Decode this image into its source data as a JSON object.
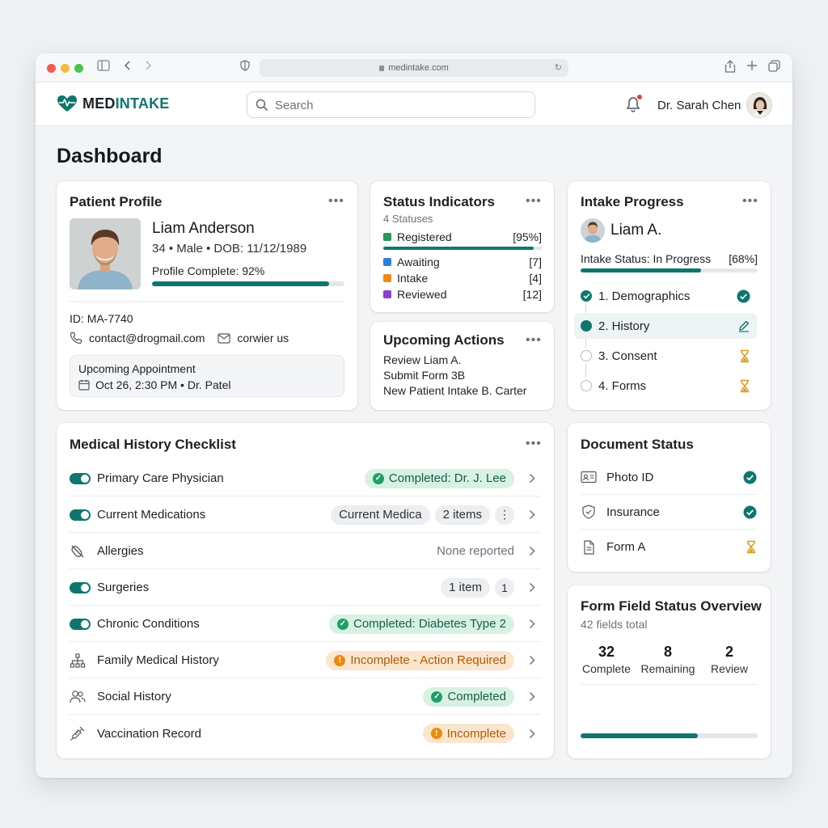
{
  "browser": {
    "url": "medintake.com"
  },
  "header": {
    "logo_med": "MED",
    "logo_intake": "INTAKE",
    "search_placeholder": "Search",
    "user_name": "Dr. Sarah Chen"
  },
  "page": {
    "title": "Dashboard"
  },
  "patient_profile": {
    "title": "Patient Profile",
    "name": "Liam Anderson",
    "meta": "34 • Male • DOB: 11/12/1989",
    "profile_complete_label": "Profile Complete: 92%",
    "profile_complete_fraction": 0.92,
    "id": "ID: MA-7740",
    "email": "contact@drogmail.com",
    "secondary_contact": "corwier us",
    "appointment_label": "Upcoming Appointment",
    "appointment_detail": "Oct 26, 2:30 PM • Dr. Patel"
  },
  "status_indicators": {
    "title": "Status Indicators",
    "subtitle": "4 Statuses",
    "registered_bar_fraction": 0.95,
    "rows": [
      {
        "label": "Registered",
        "value": "[95%]",
        "color": "#1f9d55"
      },
      {
        "label": "Awaiting",
        "value": "[7]",
        "color": "#2f7fd8"
      },
      {
        "label": "Intake",
        "value": "[4]",
        "color": "#ee8a12"
      },
      {
        "label": "Reviewed",
        "value": "[12]",
        "color": "#8a3fd1"
      }
    ]
  },
  "upcoming_actions": {
    "title": "Upcoming Actions",
    "items": [
      "Review Liam A.",
      "Submit Form 3B",
      "New Patient Intake B. Carter"
    ]
  },
  "intake_progress": {
    "title": "Intake Progress",
    "patient": "Liam A.",
    "status_label": "Intake Status: In Progress",
    "status_value": "[68%]",
    "progress_fraction": 0.68,
    "steps": [
      {
        "label": "1. Demographics",
        "state": "complete"
      },
      {
        "label": "2. History",
        "state": "active"
      },
      {
        "label": "3. Consent",
        "state": "pending"
      },
      {
        "label": "4. Forms",
        "state": "pending"
      }
    ]
  },
  "medical_history": {
    "title": "Medical History Checklist",
    "rows": [
      {
        "label": "Primary Care Physician",
        "status": "Completed: Dr. J. Lee"
      },
      {
        "label": "Current Medications",
        "chip1": "Current Medica",
        "chip2": "2 items"
      },
      {
        "label": "Allergies",
        "status": "None reported"
      },
      {
        "label": "Surgeries",
        "chip1": "1 item",
        "chip2": "1"
      },
      {
        "label": "Chronic Conditions",
        "status": "Completed: Diabetes Type 2"
      },
      {
        "label": "Family Medical History",
        "status": "Incomplete - Action Required"
      },
      {
        "label": "Social History",
        "status": "Completed"
      },
      {
        "label": "Vaccination Record",
        "status": "Incomplete"
      }
    ]
  },
  "document_status": {
    "title": "Document Status",
    "rows": [
      {
        "label": "Photo ID",
        "state": "complete"
      },
      {
        "label": "Insurance",
        "state": "complete"
      },
      {
        "label": "Form A",
        "state": "pending"
      }
    ]
  },
  "form_field_overview": {
    "title": "Form Field Status Overview",
    "subtitle": "42 fields total",
    "complete_num": "32",
    "complete_label": "Complete",
    "remaining_num": "8",
    "remaining_label": "Remaining",
    "review_num": "2",
    "review_label": "Review",
    "progress_fraction": 0.66
  },
  "colors": {
    "brand": "#0f766e",
    "success": "#1f9d6b",
    "warning": "#ea8a10",
    "pending": "#d99a1a"
  }
}
